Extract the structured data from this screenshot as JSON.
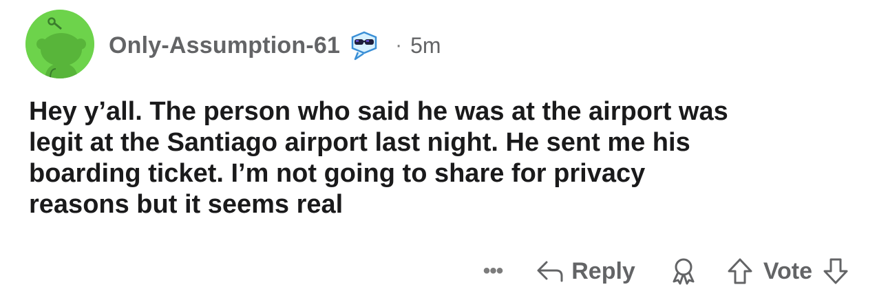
{
  "comment": {
    "author": "Only-Assumption-61",
    "separator": "·",
    "timestamp": "5m",
    "body": "Hey y’all. The person who said he was at the airport was\nlegit at the Santiago airport last night. He sent me his\nboarding ticket. I’m not going to share for privacy\nreasons but it seems real"
  },
  "actions": {
    "more_label": "•••",
    "reply_label": "Reply",
    "vote_label": "Vote"
  },
  "icons": {
    "avatar": "snoo-avatar",
    "flair": "sunglasses-snoo-flair-icon",
    "reply": "reply-arrow-icon",
    "award": "award-icon",
    "upvote": "upvote-arrow-icon",
    "downvote": "downvote-arrow-icon"
  },
  "colors": {
    "avatar_bg": "#6dd34b",
    "meta_text": "#636466",
    "body_text": "#1a1a1b"
  }
}
